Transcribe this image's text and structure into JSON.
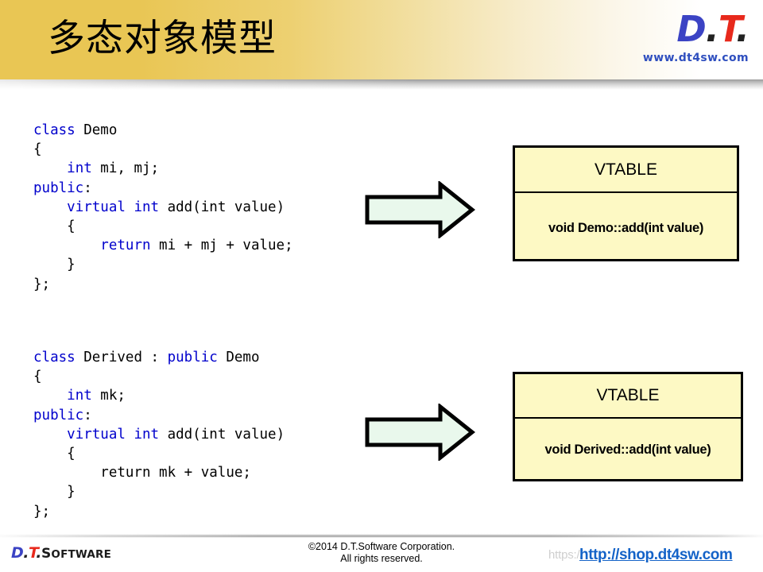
{
  "slide": {
    "title": "多态对象模型",
    "background_color": "#ffffff",
    "header_gold": "#e9c654"
  },
  "brand": {
    "d": "D",
    "dot1": ".",
    "t": "T",
    "dot2": ".",
    "url": "www.dt4sw.com",
    "blue": "#3b43c4",
    "red": "#e8291c"
  },
  "code_blocks": [
    {
      "id": "demo",
      "lines": [
        [
          {
            "t": "class",
            "kw": true
          },
          {
            "t": " Demo",
            "kw": false
          }
        ],
        [
          {
            "t": "{",
            "kw": false
          }
        ],
        [
          {
            "t": "    ",
            "kw": false
          },
          {
            "t": "int",
            "kw": true
          },
          {
            "t": " mi, mj;",
            "kw": false
          }
        ],
        [
          {
            "t": "public",
            "kw": true
          },
          {
            "t": ":",
            "kw": false
          }
        ],
        [
          {
            "t": "    ",
            "kw": false
          },
          {
            "t": "virtual int",
            "kw": true
          },
          {
            "t": " add(int value)",
            "kw": false
          }
        ],
        [
          {
            "t": "    {",
            "kw": false
          }
        ],
        [
          {
            "t": "        ",
            "kw": false
          },
          {
            "t": "return",
            "kw": true
          },
          {
            "t": " mi + mj + value;",
            "kw": false
          }
        ],
        [
          {
            "t": "    }",
            "kw": false
          }
        ],
        [
          {
            "t": "};",
            "kw": false
          }
        ]
      ]
    },
    {
      "id": "derived",
      "lines": [
        [
          {
            "t": "class",
            "kw": true
          },
          {
            "t": " Derived : ",
            "kw": false
          },
          {
            "t": "public",
            "kw": true
          },
          {
            "t": " Demo",
            "kw": false
          }
        ],
        [
          {
            "t": "{",
            "kw": false
          }
        ],
        [
          {
            "t": "    ",
            "kw": false
          },
          {
            "t": "int",
            "kw": true
          },
          {
            "t": " mk;",
            "kw": false
          }
        ],
        [
          {
            "t": "public",
            "kw": true
          },
          {
            "t": ":",
            "kw": false
          }
        ],
        [
          {
            "t": "    ",
            "kw": false
          },
          {
            "t": "virtual int",
            "kw": true
          },
          {
            "t": " add(int value)",
            "kw": false
          }
        ],
        [
          {
            "t": "    {",
            "kw": false
          }
        ],
        [
          {
            "t": "        return mk + value;",
            "kw": false
          }
        ],
        [
          {
            "t": "    }",
            "kw": false
          }
        ],
        [
          {
            "t": "};",
            "kw": false
          }
        ]
      ]
    }
  ],
  "code_colors": {
    "keyword": "#0000cc",
    "text": "#000000"
  },
  "arrows": [
    {
      "name": "arrow-demo-to-vtable",
      "fill": "#e9f8ec",
      "stroke": "#000000"
    },
    {
      "name": "arrow-derived-to-vtable",
      "fill": "#e9f8ec",
      "stroke": "#000000"
    }
  ],
  "vtables": [
    {
      "id": "demo",
      "header": "VTABLE",
      "entry": "void Demo::add(int value)",
      "fill": "#fdf9c4",
      "border": "#000000"
    },
    {
      "id": "derived",
      "header": "VTABLE",
      "entry": "void Derived::add(int value)",
      "fill": "#fdf9c4",
      "border": "#000000"
    }
  ],
  "footer": {
    "logo_d": "D",
    "logo_dot1": ".",
    "logo_t": "T",
    "logo_dot2": ".",
    "logo_software_s": "S",
    "logo_software_rest": "OFTWARE",
    "copyright_line1": "©2014 D.T.Software Corporation.",
    "copyright_line2": "All rights reserved.",
    "shop_ghost": "https://",
    "shop_link": "http://shop.dt4sw.com",
    "shop_link_color": "#1463c8"
  }
}
